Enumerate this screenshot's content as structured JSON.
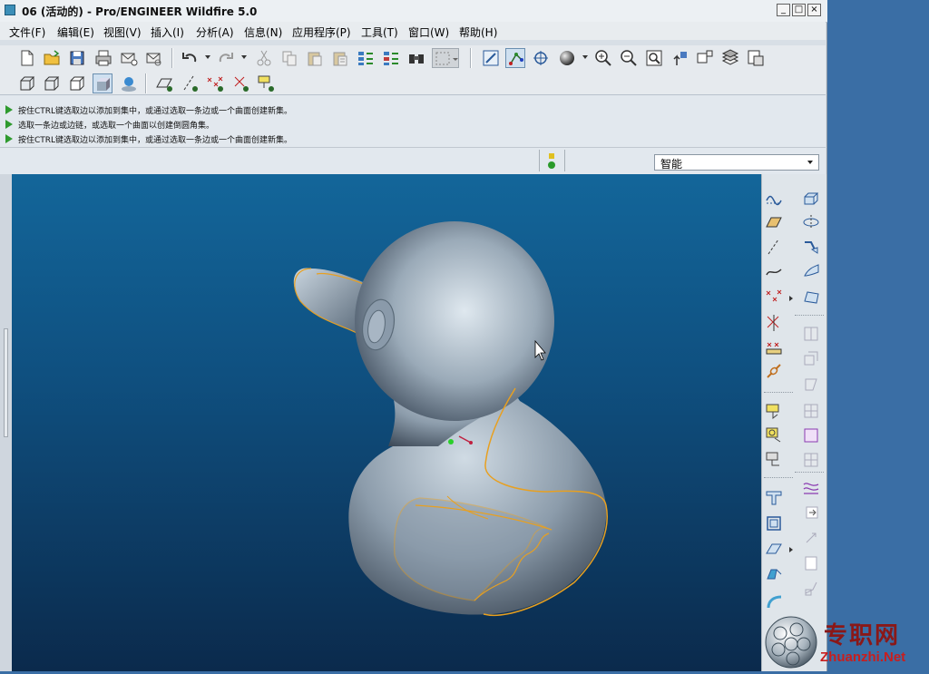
{
  "window": {
    "title": "06 (活动的) - Pro/ENGINEER Wildfire 5.0"
  },
  "window_controls": {
    "minimize": "_",
    "maximize": "□",
    "close": "×"
  },
  "menu": [
    {
      "label": "文件(F)"
    },
    {
      "label": "编辑(E)"
    },
    {
      "label": "视图(V)"
    },
    {
      "label": "插入(I)"
    },
    {
      "label": "分析(A)"
    },
    {
      "label": "信息(N)"
    },
    {
      "label": "应用程序(P)"
    },
    {
      "label": "工具(T)"
    },
    {
      "label": "窗口(W)"
    },
    {
      "label": "帮助(H)"
    }
  ],
  "messages": [
    "按住CTRL键选取边以添加到集中，或通过选取一条边或一个曲面创建新集。",
    "选取一条边或边链，或选取一个曲面以创建倒圆角集。",
    "按住CTRL键选取边以添加到集中，或通过选取一条边或一个曲面创建新集。"
  ],
  "filter": {
    "value": "智能"
  },
  "watermark": {
    "cn": "专职网",
    "en": "Zhuanzhi.Net"
  },
  "colors": {
    "viewport_top": "#13669a",
    "viewport_bottom": "#0b2a4c",
    "selection_edge": "#e8a020",
    "message_arrow": "#2e9a2e"
  }
}
